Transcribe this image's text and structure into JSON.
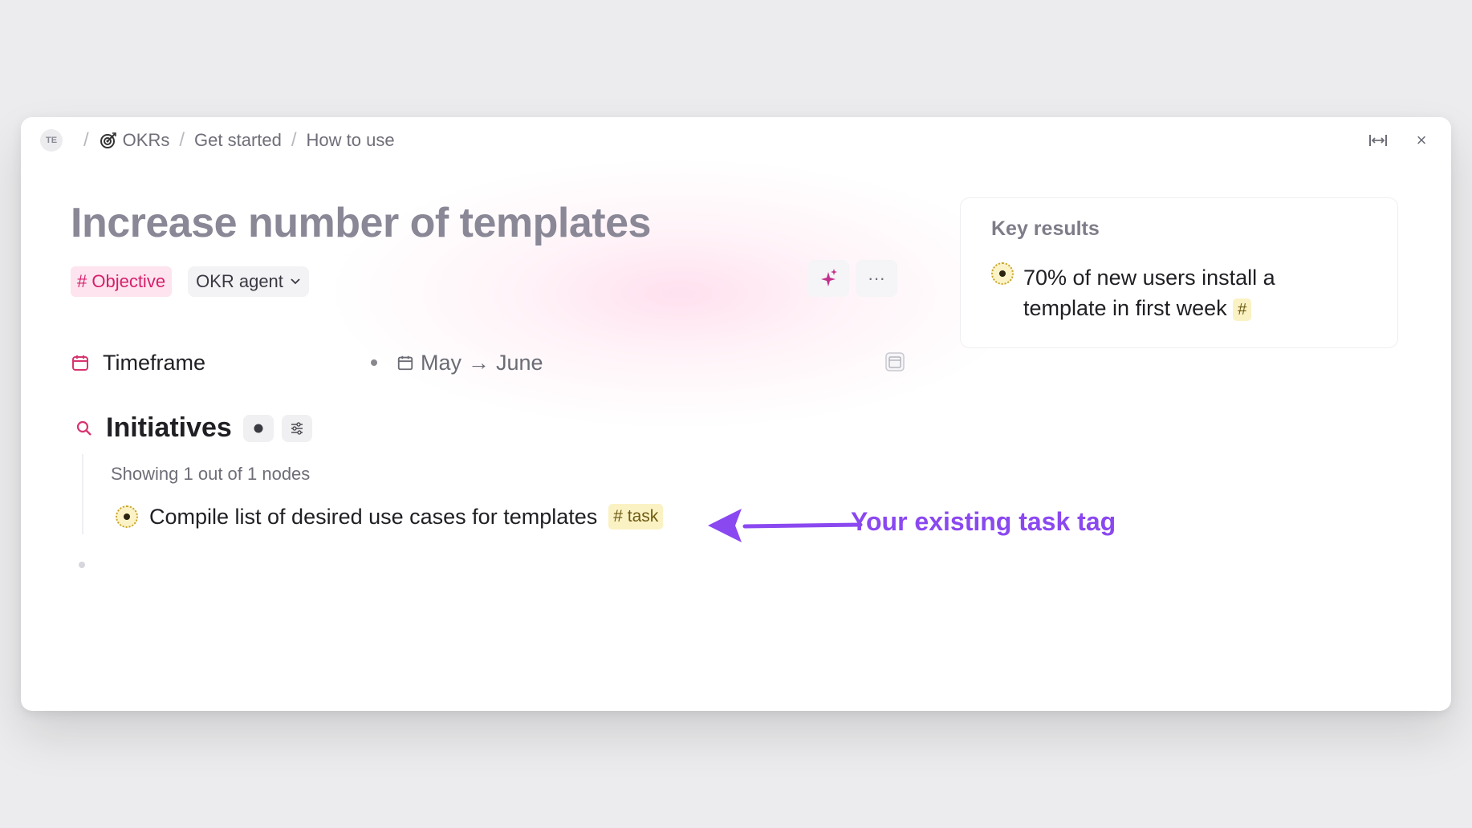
{
  "breadcrumb": {
    "avatar": "TE",
    "items": [
      "OKRs",
      "Get started",
      "How to use"
    ],
    "separator": "/"
  },
  "window_actions": {
    "expand_icon": "expand-width-icon",
    "close_icon": "close-icon",
    "close_label": "×"
  },
  "page": {
    "title": "Increase number of templates",
    "supertag": "# Objective",
    "agent_label": "OKR agent",
    "more_label": "···"
  },
  "timeframe": {
    "label": "Timeframe",
    "start": "May",
    "arrow": "→",
    "end": "June"
  },
  "initiatives": {
    "title": "Initiatives",
    "showing": "Showing 1 out of 1 nodes",
    "items": [
      {
        "text": "Compile list of desired use cases for templates",
        "tag": "# task"
      }
    ]
  },
  "annotation": {
    "text": "Your existing task tag",
    "color": "#8a48f0"
  },
  "key_results": {
    "title": "Key results",
    "items": [
      {
        "text": "70% of new users install a template in first week",
        "tag": "#"
      }
    ]
  },
  "colors": {
    "objective_tag_bg": "#fde4ee",
    "objective_tag_text": "#d61f6b",
    "task_tag_bg": "#fbf2c4",
    "title_color": "#8a8796"
  }
}
